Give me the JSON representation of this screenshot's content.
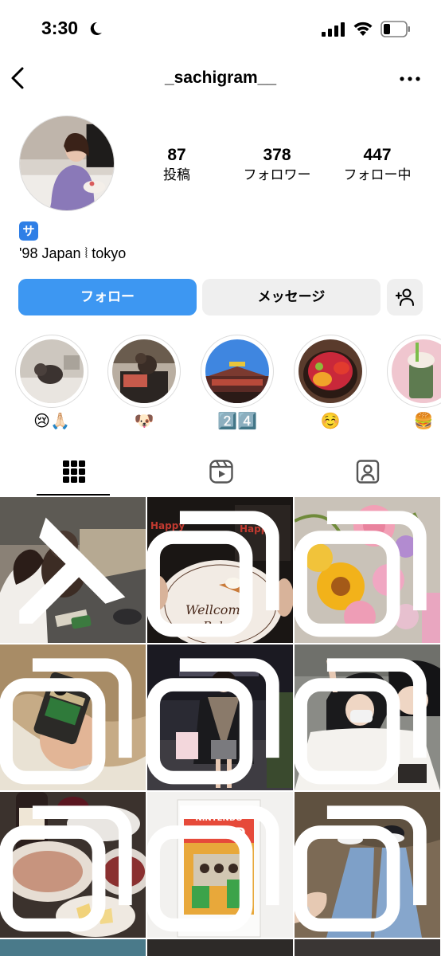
{
  "status_bar": {
    "time": "3:30"
  },
  "nav": {
    "username": "_sachigram__"
  },
  "profile": {
    "stats": [
      {
        "value": "87",
        "label": "投稿"
      },
      {
        "value": "378",
        "label": "フォロワー"
      },
      {
        "value": "447",
        "label": "フォロー中"
      }
    ],
    "badge": "サ",
    "bio": "'98 Japan ⦚ tokyo"
  },
  "actions": {
    "follow_label": "フォロー",
    "message_label": "メッセージ"
  },
  "highlights": [
    {
      "label": "😢🙏🏻",
      "icon": "dog-on-bed"
    },
    {
      "label": "🐶",
      "icon": "dog-in-cart"
    },
    {
      "label": "2️⃣4️⃣",
      "icon": "temple-gate"
    },
    {
      "label": "☺️",
      "icon": "sushi-bowl"
    },
    {
      "label": "🍔",
      "icon": "drink"
    }
  ],
  "tabs": [
    {
      "name": "grid",
      "active": true
    },
    {
      "name": "reels",
      "active": false
    },
    {
      "name": "tagged",
      "active": false
    }
  ],
  "colors": {
    "accent": "#3d97f2",
    "secondary_button": "#efefef"
  },
  "posts": [
    {
      "subject": "woman-with-poodle",
      "badge": "pin-icon"
    },
    {
      "subject": "wellcome-baby-cake",
      "badge": "carousel-icon"
    },
    {
      "subject": "flower-bouquet",
      "badge": "carousel-icon"
    },
    {
      "subject": "disposable-camera-beach",
      "badge": "carousel-icon"
    },
    {
      "subject": "woman-street-night",
      "badge": "carousel-icon"
    },
    {
      "subject": "friends-selfie",
      "badge": "carousel-icon"
    },
    {
      "subject": "wine-dinner",
      "badge": "carousel-icon"
    },
    {
      "subject": "nintendo-world-instax",
      "badge": "carousel-icon"
    },
    {
      "subject": "jeans-sneakers",
      "badge": "carousel-icon"
    }
  ],
  "cake_text": {
    "line1": "Wellcome",
    "line2": "Baby"
  },
  "poster_text": {
    "line1": "NINTENDO",
    "line2": "WORLD"
  }
}
